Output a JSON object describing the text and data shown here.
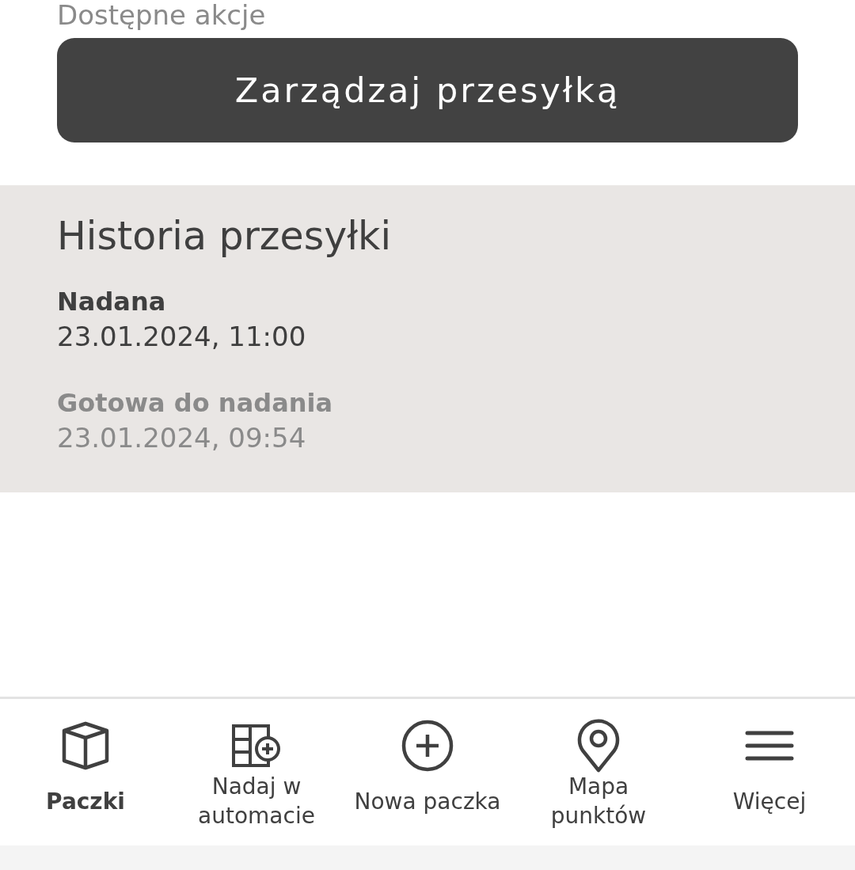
{
  "actions": {
    "label": "Dostępne akcje",
    "button": "Zarządzaj przesyłką"
  },
  "history": {
    "title": "Historia przesyłki",
    "events": [
      {
        "status": "Nadana",
        "time": "23.01.2024, 11:00",
        "current": true
      },
      {
        "status": "Gotowa do nadania",
        "time": "23.01.2024, 09:54",
        "current": false
      }
    ]
  },
  "bottom_nav": [
    {
      "label": "Paczki",
      "selected": true
    },
    {
      "label": "Nadaj w automacie",
      "selected": false
    },
    {
      "label": "Nowa paczka",
      "selected": false
    },
    {
      "label": "Mapa punktów",
      "selected": false
    },
    {
      "label": "Więcej",
      "selected": false
    }
  ]
}
